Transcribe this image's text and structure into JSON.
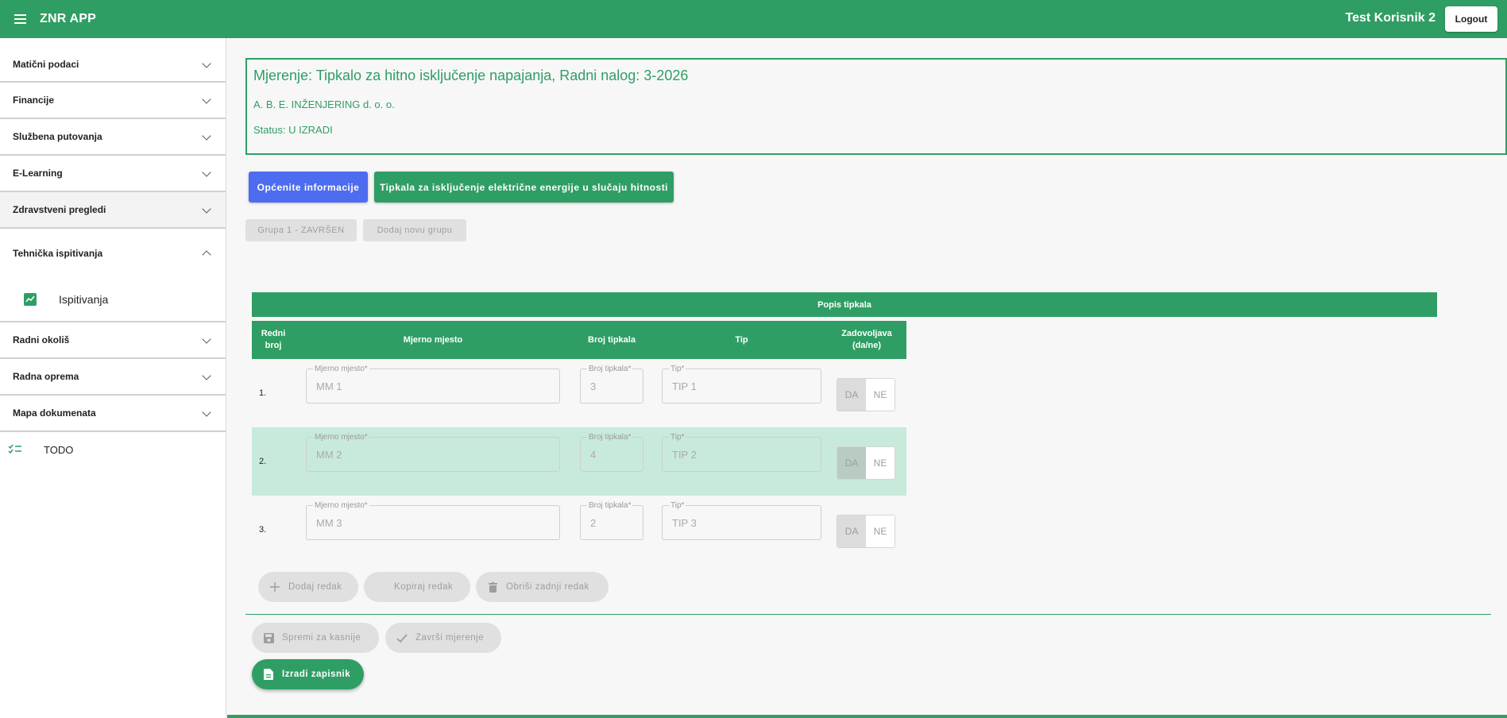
{
  "app": {
    "title": "ZNR APP",
    "user": "Test Korisnik 2",
    "logout_label": "Logout"
  },
  "sidebar": {
    "items": [
      {
        "label": "Matični podaci"
      },
      {
        "label": "Financije"
      },
      {
        "label": "Službena putovanja"
      },
      {
        "label": "E-Learning"
      },
      {
        "label": "Zdravstveni pregledi"
      },
      {
        "label": "Tehnička ispitivanja"
      },
      {
        "label": "Radni okoliš"
      },
      {
        "label": "Radna oprema"
      },
      {
        "label": "Mapa dokumenata"
      }
    ],
    "sub_item": {
      "label": "Ispitivanja",
      "icon": "chart-icon"
    },
    "todo": {
      "label": "TODO",
      "icon": "checklist-icon"
    }
  },
  "header": {
    "title": "Mjerenje: Tipkalo za hitno isključenje napajanja, Radni nalog: 3-2026",
    "company": "A. B. E. INŽENJERING d. o. o.",
    "status": "Status: U IZRADI"
  },
  "tabs": [
    {
      "label": "Općenite informacije"
    },
    {
      "label": "Tipkala za isključenje električne energije u slučaju hitnosti"
    }
  ],
  "groups": [
    {
      "label": "Grupa 1 - ZAVRŠEN"
    },
    {
      "label": "Dodaj novu grupu"
    }
  ],
  "table": {
    "title": "Popis tipkala",
    "headers": {
      "redni_broj": "Redni broj",
      "mjerno_mjesto": "Mjerno mjesto",
      "broj_tipkala": "Broj tipkala",
      "tip": "Tip",
      "zadovoljava": "Zadovoljava (da/ne)"
    },
    "field_labels": {
      "mjerno_mjesto": "Mjerno mjesto*",
      "broj_tipkala": "Broj tipkala*",
      "tip": "Tip*"
    },
    "da_label": "DA",
    "ne_label": "NE",
    "rows": [
      {
        "num": "1.",
        "mjerno_mjesto": "MM 1",
        "broj_tipkala": "3",
        "tip": "TIP 1"
      },
      {
        "num": "2.",
        "mjerno_mjesto": "MM 2",
        "broj_tipkala": "4",
        "tip": "TIP 2"
      },
      {
        "num": "3.",
        "mjerno_mjesto": "MM 3",
        "broj_tipkala": "2",
        "tip": "TIP 3"
      }
    ]
  },
  "actions": {
    "add_row": "Dodaj redak",
    "copy_row": "Kopiraj redak",
    "delete_last_row": "Obriši zadnji redak",
    "save_later": "Spremi za kasnije",
    "finish": "Završi mjerenje",
    "create_report": "Izradi zapisnik"
  },
  "colors": {
    "primary": "#2f9e64",
    "accent": "#4e6cf0",
    "row_highlight": "#c8eadb"
  }
}
